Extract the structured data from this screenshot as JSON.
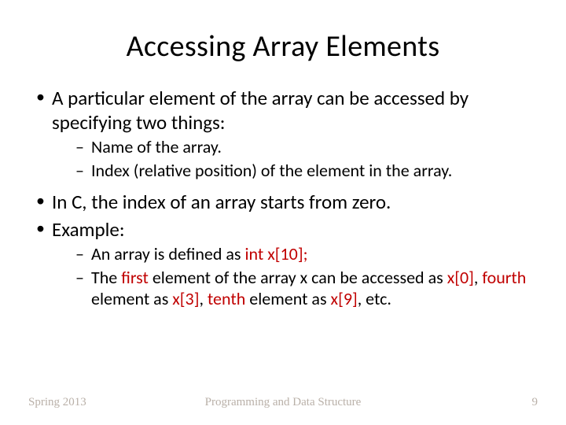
{
  "title": "Accessing Array Elements",
  "bullets": {
    "b1": "A particular element of the array can be accessed by specifying two things:",
    "b1a": "Name of the array.",
    "b1b": "Index (relative position) of the element in the array.",
    "b2": "In C, the index of an array starts from zero.",
    "b3": "Example:",
    "b3a_pre": "An array is defined as   ",
    "b3a_code": "int  x[10];",
    "b3b_t1": "The ",
    "b3b_first": "first",
    "b3b_t2": " element of the array x can be accessed as ",
    "b3b_x0": "x[0]",
    "b3b_t3": ", ",
    "b3b_fourth": "fourth",
    "b3b_t4": " element as ",
    "b3b_x3": "x[3]",
    "b3b_t5": ", ",
    "b3b_tenth": "tenth",
    "b3b_t6": " element as ",
    "b3b_x9": "x[9]",
    "b3b_t7": ", etc."
  },
  "footer": {
    "left": "Spring 2013",
    "center": "Programming and Data Structure",
    "right": "9"
  }
}
